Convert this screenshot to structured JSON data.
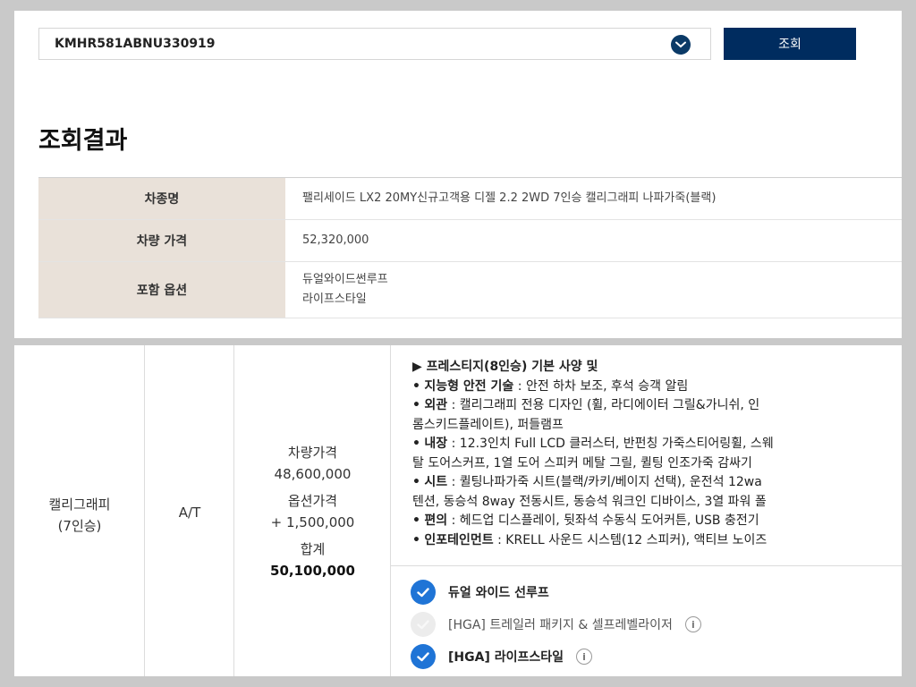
{
  "search": {
    "vin": "KMHR581ABNU330919",
    "button_label": "조회"
  },
  "result": {
    "title": "조회결과",
    "rows": [
      {
        "label": "차종명",
        "lines": [
          "팰리세이드 LX2 20MY신규고객용 디젤 2.2 2WD 7인승 캘리그래피 나파가죽(블랙)"
        ]
      },
      {
        "label": "차량 가격",
        "lines": [
          "52,320,000"
        ]
      },
      {
        "label": "포함 옵션",
        "lines": [
          "듀얼와이드썬루프",
          "라이프스타일"
        ]
      }
    ]
  },
  "trim": {
    "name_line1": "캘리그래피",
    "name_line2": "(7인승)",
    "transmission": "A/T",
    "price_label": "차량가격",
    "price_value": "48,600,000",
    "option_price_label": "옵션가격",
    "option_price_value": "+ 1,500,000",
    "total_label": "합계",
    "total_value": "50,100,000"
  },
  "spec": {
    "title": "▶ 프레스티지(8인승) 기본 사양 및",
    "lines": [
      {
        "bullet": "•",
        "key": "지능형 안전 기술",
        "text": " : 안전 하차 보조, 후석 승객 알림"
      },
      {
        "bullet": "•",
        "key": "외관",
        "text": " : 캘리그래피 전용 디자인 (휠, 라디에이터 그릴&가니쉬, 인"
      },
      {
        "bullet": "",
        "key": "",
        "text": "롬스키드플레이트), 퍼들램프"
      },
      {
        "bullet": "•",
        "key": "내장",
        "text": " : 12.3인치 Full LCD 클러스터, 반펀칭 가죽스티어링휠, 스웨"
      },
      {
        "bullet": "",
        "key": "",
        "text": "탈 도어스커프, 1열 도어 스피커 메탈 그릴, 퀼팅 인조가죽 감싸기"
      },
      {
        "bullet": "•",
        "key": "시트",
        "text": " : 퀼팅나파가죽 시트(블랙/카키/베이지 선택), 운전석 12wa"
      },
      {
        "bullet": "",
        "key": "",
        "text": "텐션, 동승석 8way 전동시트, 동승석 워크인 디바이스, 3열 파워 폴"
      },
      {
        "bullet": "•",
        "key": "편의",
        "text": " : 헤드업 디스플레이, 뒷좌석 수동식 도어커튼, USB 충전기"
      },
      {
        "bullet": "•",
        "key": "인포테인먼트",
        "text": " : KRELL 사운드 시스템(12 스피커), 액티브 노이즈"
      }
    ]
  },
  "options": [
    {
      "label": "듀얼 와이드 선루프",
      "checked": true,
      "info": false
    },
    {
      "label": "[HGA] 트레일러 패키지 & 셀프레벨라이저",
      "checked": false,
      "info": true
    },
    {
      "label": "[HGA] 라이프스타일",
      "checked": true,
      "info": true
    }
  ],
  "icons": {
    "info_glyph": "i"
  },
  "colors": {
    "primary_button": "#002c5f",
    "check_on": "#1f74d6",
    "header_bg": "#e9e1d9"
  }
}
